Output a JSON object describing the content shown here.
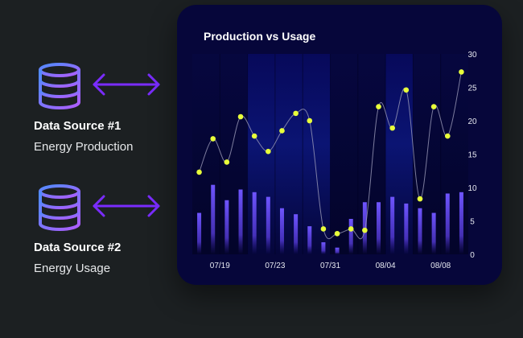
{
  "sources": [
    {
      "title": "Data Source #1",
      "subtitle": "Energy Production",
      "icon": "database-icon"
    },
    {
      "title": "Data Source #2",
      "subtitle": "Energy Usage",
      "icon": "database-icon"
    }
  ],
  "colors": {
    "background": "#1c2022",
    "card": "#06063a",
    "plot_band_dark": "#06073f",
    "plot_band_light": "#0b1473",
    "bar": "#6f55ff",
    "line": "#9a9ab8",
    "point": "#e8ff3a",
    "arrow": "#7a2cff",
    "icon_gradient_start": "#4f8cff",
    "icon_gradient_end": "#b05cff"
  },
  "chart_data": {
    "type": "bar",
    "title": "Production vs Usage",
    "x_ticks": [
      "07/19",
      "07/23",
      "07/31",
      "08/04",
      "08/08"
    ],
    "ylim": [
      0,
      30
    ],
    "y_ticks": [
      0,
      5,
      10,
      15,
      20,
      25,
      30
    ],
    "y_axis_position": "right",
    "grid": false,
    "series": [
      {
        "kind": "bar",
        "values": [
          6.2,
          10.4,
          8.1,
          9.7,
          9.3,
          8.6,
          6.9,
          6.0,
          4.2,
          1.8,
          1.0,
          5.3,
          7.8,
          7.8,
          8.6,
          7.6,
          6.9,
          6.2,
          9.1,
          9.3
        ]
      },
      {
        "kind": "line",
        "values": [
          12.3,
          17.3,
          13.8,
          20.6,
          17.7,
          15.4,
          18.5,
          21.1,
          20.0,
          3.8,
          3.1,
          3.8,
          3.6,
          22.1,
          18.9,
          24.6,
          8.3,
          22.1,
          17.7,
          27.3
        ]
      }
    ]
  }
}
